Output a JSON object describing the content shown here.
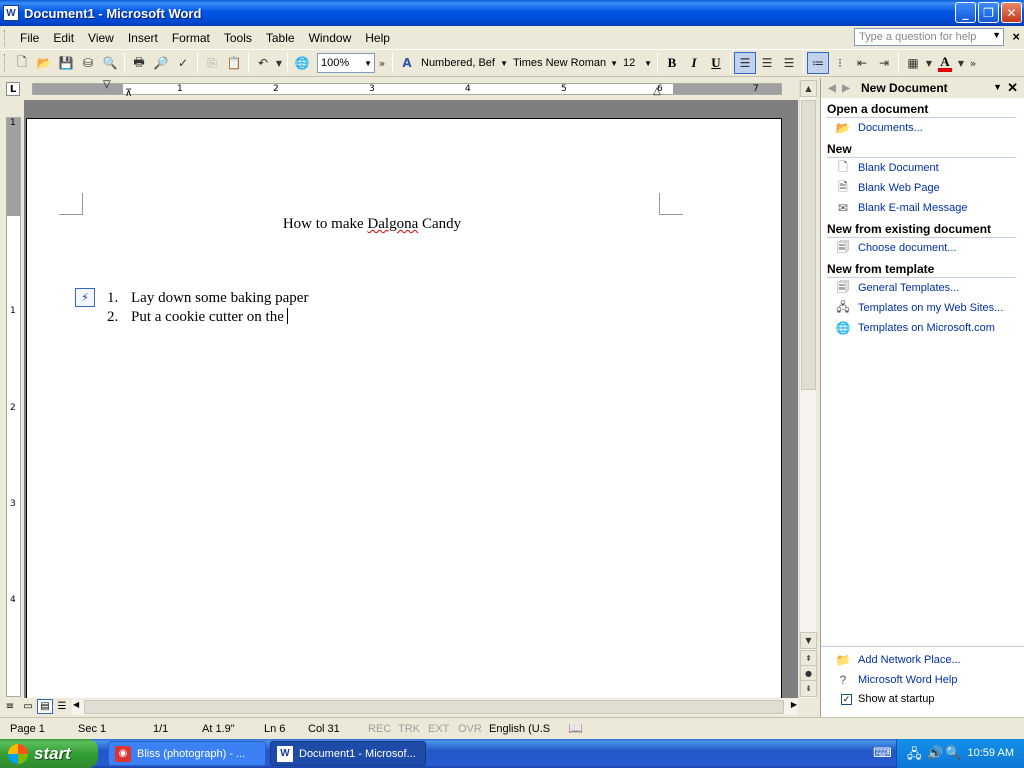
{
  "window": {
    "app_icon": "W",
    "title": "Document1 - Microsoft Word",
    "buttons": {
      "minimize": "_",
      "maximize": "❐",
      "close": "✕"
    }
  },
  "menu": {
    "items": [
      "File",
      "Edit",
      "View",
      "Insert",
      "Format",
      "Tools",
      "Table",
      "Window",
      "Help"
    ],
    "help_placeholder": "Type a question for help",
    "close_doc": "×"
  },
  "toolbar": {
    "zoom": "100%",
    "style": "Numbered, Bef",
    "font": "Times New Roman",
    "size": "12",
    "bold": "B",
    "italic": "I",
    "underline": "U",
    "font_color_label": "A",
    "font_color": "#e00000",
    "overflow": "»"
  },
  "ruler": {
    "numbers": [
      "1",
      "2",
      "3",
      "4",
      "5",
      "6",
      "7"
    ],
    "vertical_numbers": [
      "1",
      "1",
      "2",
      "3",
      "4"
    ],
    "tab_selector": "L"
  },
  "document": {
    "title_before": "How to make ",
    "title_misspelled": "Dalgona",
    "title_after": " Candy",
    "list": [
      {
        "num": "1.",
        "text": "Lay down some baking paper"
      },
      {
        "num": "2.",
        "text": "Put a cookie cutter on the"
      }
    ]
  },
  "task_pane": {
    "title": "New Document",
    "sections": [
      {
        "heading": "Open a document",
        "links": [
          {
            "label": "Documents...",
            "icon": "open-folder-icon"
          }
        ]
      },
      {
        "heading": "New",
        "links": [
          {
            "label": "Blank Document",
            "icon": "blank-document-icon"
          },
          {
            "label": "Blank Web Page",
            "icon": "web-page-icon"
          },
          {
            "label": "Blank E-mail Message",
            "icon": "email-icon"
          }
        ]
      },
      {
        "heading": "New from existing document",
        "links": [
          {
            "label": "Choose document...",
            "icon": "word-doc-icon"
          }
        ]
      },
      {
        "heading": "New from template",
        "links": [
          {
            "label": "General Templates...",
            "icon": "template-icon"
          },
          {
            "label": "Templates on my Web Sites...",
            "icon": "web-templates-icon"
          },
          {
            "label": "Templates on Microsoft.com",
            "icon": "globe-icon"
          }
        ]
      }
    ],
    "bottom_links": [
      {
        "label": "Add Network Place...",
        "icon": "network-folder-icon"
      },
      {
        "label": "Microsoft Word Help",
        "icon": "help-icon"
      }
    ],
    "show_at_startup": "Show at startup"
  },
  "status": {
    "page": "Page  1",
    "sec": "Sec  1",
    "pages": "1/1",
    "at": "At  1.9\"",
    "ln": "Ln  6",
    "col": "Col  31",
    "rec": "REC",
    "trk": "TRK",
    "ext": "EXT",
    "ovr": "OVR",
    "language": "English (U.S"
  },
  "taskbar": {
    "start": "start",
    "tasks": [
      {
        "label": "Bliss (photograph) - ...",
        "icon": "browser-icon"
      },
      {
        "label": "Document1 - Microsof...",
        "icon": "word-icon"
      }
    ],
    "clock": "10:59 AM"
  }
}
